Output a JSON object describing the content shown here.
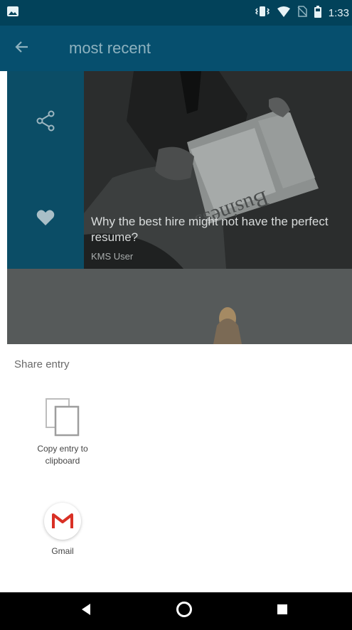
{
  "status_bar": {
    "time": "1:33",
    "icons": [
      "image-icon",
      "vibrate-icon",
      "wifi-icon",
      "no-sim-icon",
      "battery-icon"
    ]
  },
  "toolbar": {
    "title": "most recent",
    "back_icon": "arrow-back-icon",
    "background": "#064f6e"
  },
  "rail": {
    "share_icon": "share-icon",
    "favorite_icon": "heart-icon"
  },
  "card": {
    "title": "Why the best hire might not have the perfect resume?",
    "author": "KMS User",
    "newspaper_text": "Business"
  },
  "sheet": {
    "title": "Share entry",
    "options": [
      {
        "label": "Copy entry to clipboard",
        "icon": "copy-icon"
      },
      {
        "label": "Gmail",
        "icon": "gmail-icon"
      }
    ]
  },
  "nav": {
    "back": "back-icon",
    "home": "home-icon",
    "recents": "recents-icon"
  }
}
